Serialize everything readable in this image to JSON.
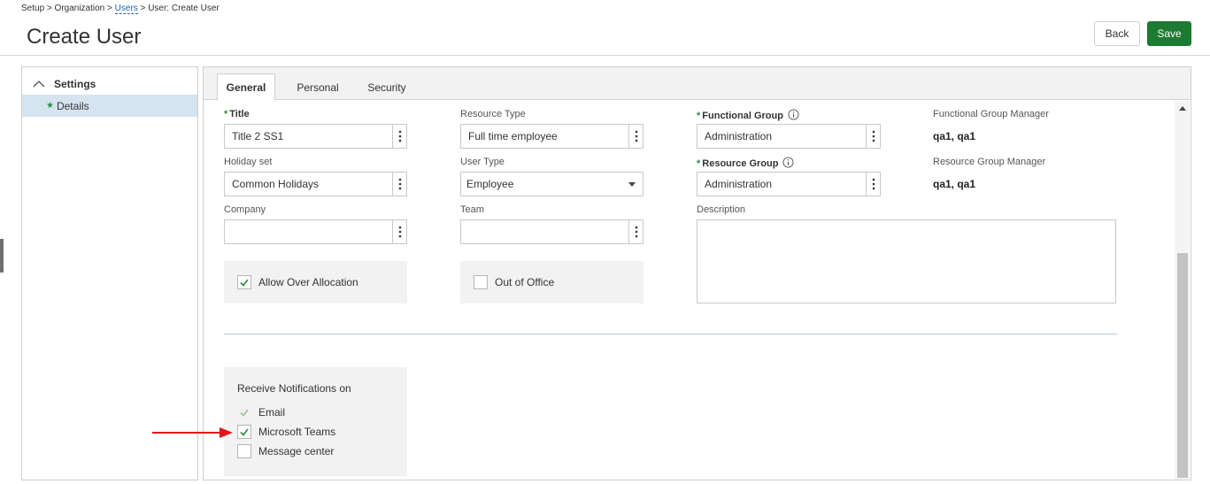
{
  "breadcrumb": {
    "setup": "Setup",
    "organization": "Organization",
    "users": "Users",
    "current": "User: Create User",
    "sep": " > "
  },
  "page": {
    "title": "Create User"
  },
  "toolbar": {
    "back_label": "Back",
    "save_label": "Save"
  },
  "sidebar": {
    "section_label": "Settings",
    "section_icon": "chevron-up-icon",
    "items": [
      {
        "label": "Details",
        "icon": "star-icon",
        "selected": true
      }
    ]
  },
  "tabs": [
    {
      "label": "General",
      "active": true
    },
    {
      "label": "Personal",
      "active": false
    },
    {
      "label": "Security",
      "active": false
    }
  ],
  "form": {
    "title": {
      "label": "Title",
      "required": true,
      "value": "Title 2 SS1"
    },
    "holiday_set": {
      "label": "Holiday set",
      "value": "Common Holidays"
    },
    "company": {
      "label": "Company",
      "value": ""
    },
    "resource_type": {
      "label": "Resource Type",
      "value": "Full time employee"
    },
    "user_type": {
      "label": "User Type",
      "value": "Employee"
    },
    "team": {
      "label": "Team",
      "value": ""
    },
    "functional_group": {
      "label": "Functional Group",
      "required": true,
      "value": "Administration"
    },
    "resource_group": {
      "label": "Resource Group",
      "required": true,
      "value": "Administration"
    },
    "description": {
      "label": "Description",
      "value": ""
    },
    "functional_group_manager": {
      "label": "Functional Group Manager",
      "value": "qa1, qa1"
    },
    "resource_group_manager": {
      "label": "Resource Group Manager",
      "value": "qa1, qa1"
    },
    "allow_over_allocation": {
      "label": "Allow Over Allocation",
      "checked": true
    },
    "out_of_office": {
      "label": "Out of Office",
      "checked": false
    }
  },
  "notifications": {
    "title": "Receive Notifications on",
    "options": [
      {
        "label": "Email",
        "checked": true,
        "disabled": true
      },
      {
        "label": "Microsoft Teams",
        "checked": true,
        "disabled": false
      },
      {
        "label": "Message center",
        "checked": false,
        "disabled": false
      }
    ]
  },
  "colors": {
    "save_button": "#1d7a32",
    "check_mark": "#2e8b3d",
    "selected_row": "#d6e4f0",
    "link": "#1a64b0",
    "annotation_arrow": "#e0161b"
  }
}
